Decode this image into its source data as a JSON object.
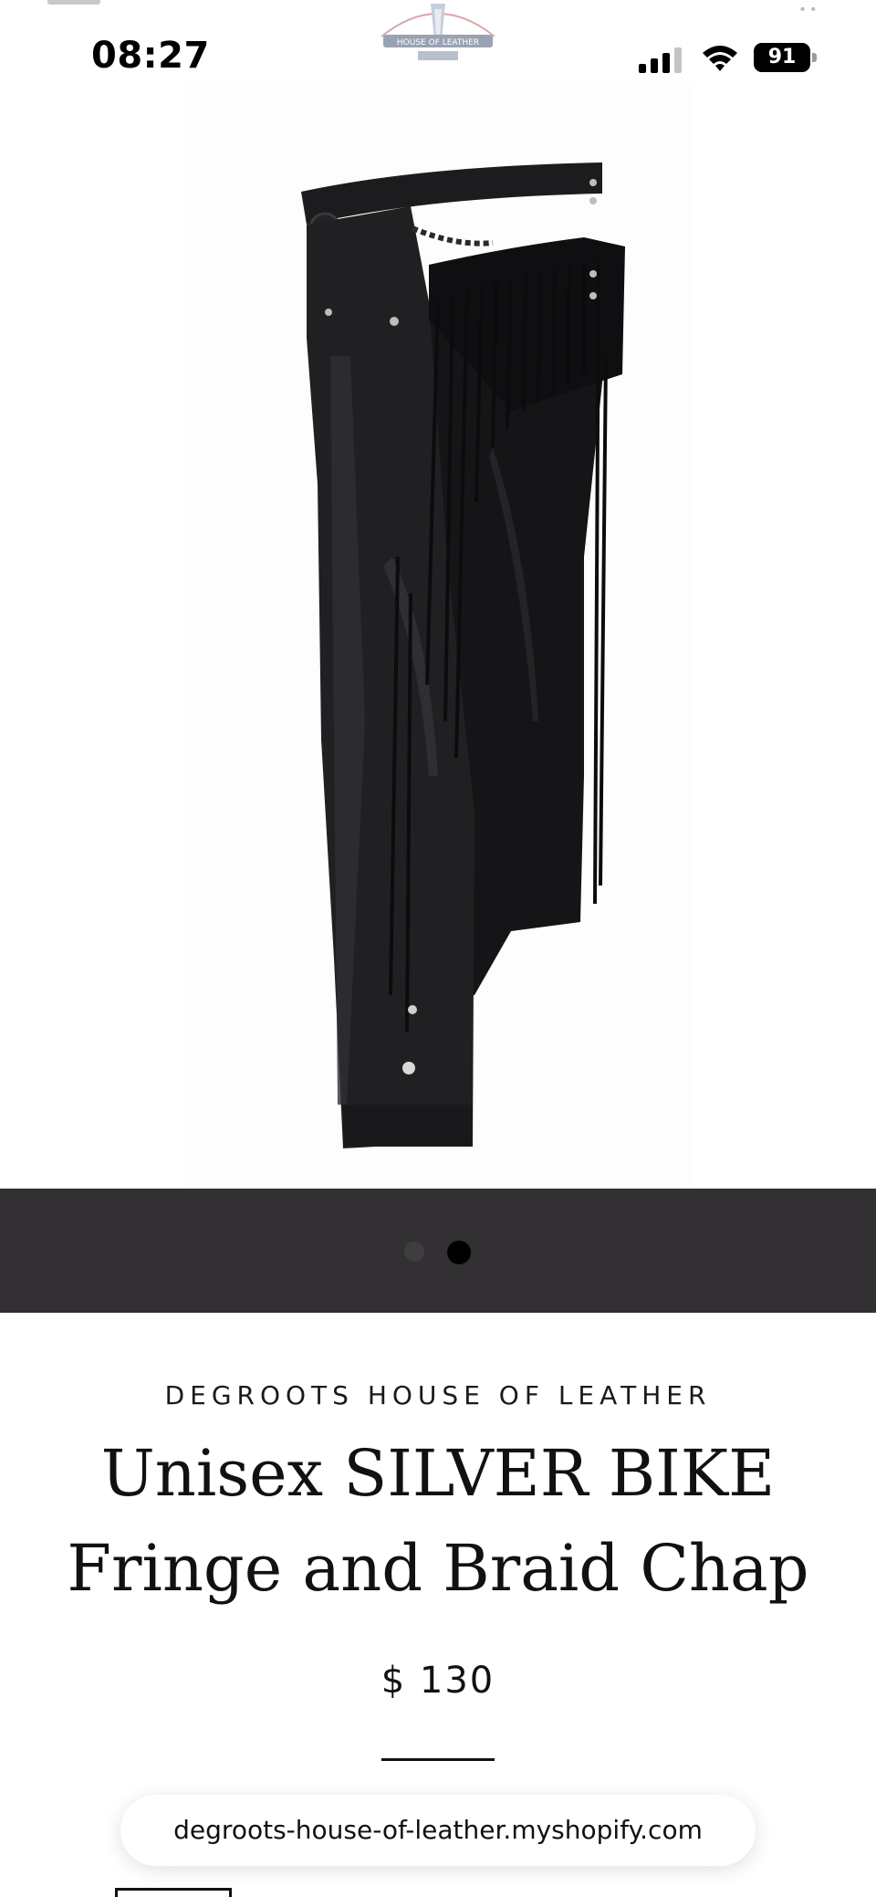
{
  "status_bar": {
    "time": "08:27",
    "battery": "91",
    "icons": [
      "signal-icon",
      "wifi-icon",
      "battery-icon"
    ]
  },
  "header": {
    "logo_icon": "house-of-leather-logo",
    "logo_text": "HOUSE OF LEATHER"
  },
  "product": {
    "image_icon": "leather-chaps-image",
    "carousel": {
      "count": 2,
      "active_index": 1
    },
    "vendor": "DEGROOTS HOUSE OF LEATHER",
    "title": "Unisex SILVER BIKE Fringe and Braid Chap",
    "price": "$ 130"
  },
  "browser": {
    "url": "degroots-house-of-leather.myshopify.com"
  },
  "colors": {
    "carousel_bg": "#323032",
    "active_dot": "#000000",
    "inactive_dot": "#3f3d3f"
  }
}
